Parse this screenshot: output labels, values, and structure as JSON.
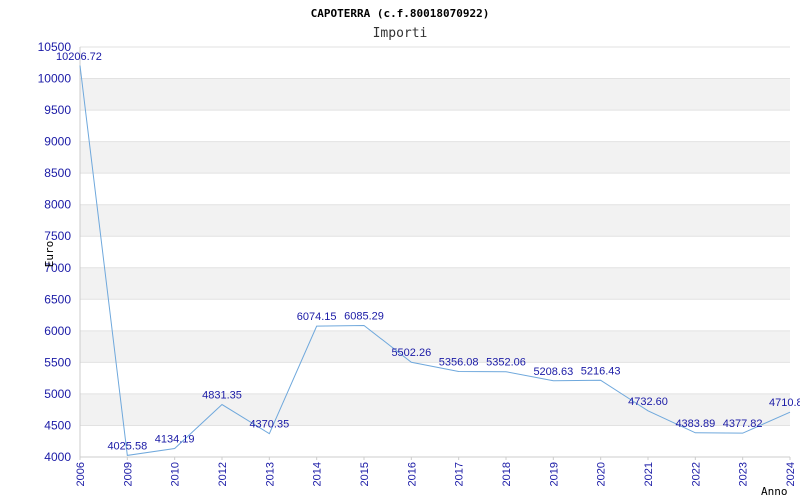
{
  "chart_data": {
    "type": "line",
    "title": "CAPOTERRA (c.f.80018070922)",
    "subtitle": "Importi",
    "ylabel": "Euro",
    "xlabel": "Anno",
    "ylim": [
      4000,
      10500
    ],
    "yticks": [
      4000,
      4500,
      5000,
      5500,
      6000,
      6500,
      7000,
      7500,
      8000,
      8500,
      9000,
      9500,
      10000,
      10500
    ],
    "grid": true,
    "colors": {
      "line": "#6fa8dc",
      "band": "#f2f2f2",
      "axis_text": "#1a1aa6"
    },
    "categories": [
      "2006",
      "2009",
      "2010",
      "2012",
      "2013",
      "2014",
      "2015",
      "2016",
      "2017",
      "2018",
      "2019",
      "2020",
      "2021",
      "2022",
      "2023",
      "2024"
    ],
    "values": [
      10206.72,
      4025.58,
      4134.19,
      4831.35,
      4370.35,
      6074.15,
      6085.29,
      5502.26,
      5356.08,
      5352.06,
      5208.63,
      5216.43,
      4732.6,
      4383.89,
      4377.82,
      4710.8
    ],
    "labels": [
      "10206.72",
      "4025.58",
      "4134.19",
      "4831.35",
      "4370.35",
      "6074.15",
      "6085.29",
      "5502.26",
      "5356.08",
      "5352.06",
      "5208.63",
      "5216.43",
      "4732.60",
      "4383.89",
      "4377.82",
      "4710.8"
    ]
  }
}
